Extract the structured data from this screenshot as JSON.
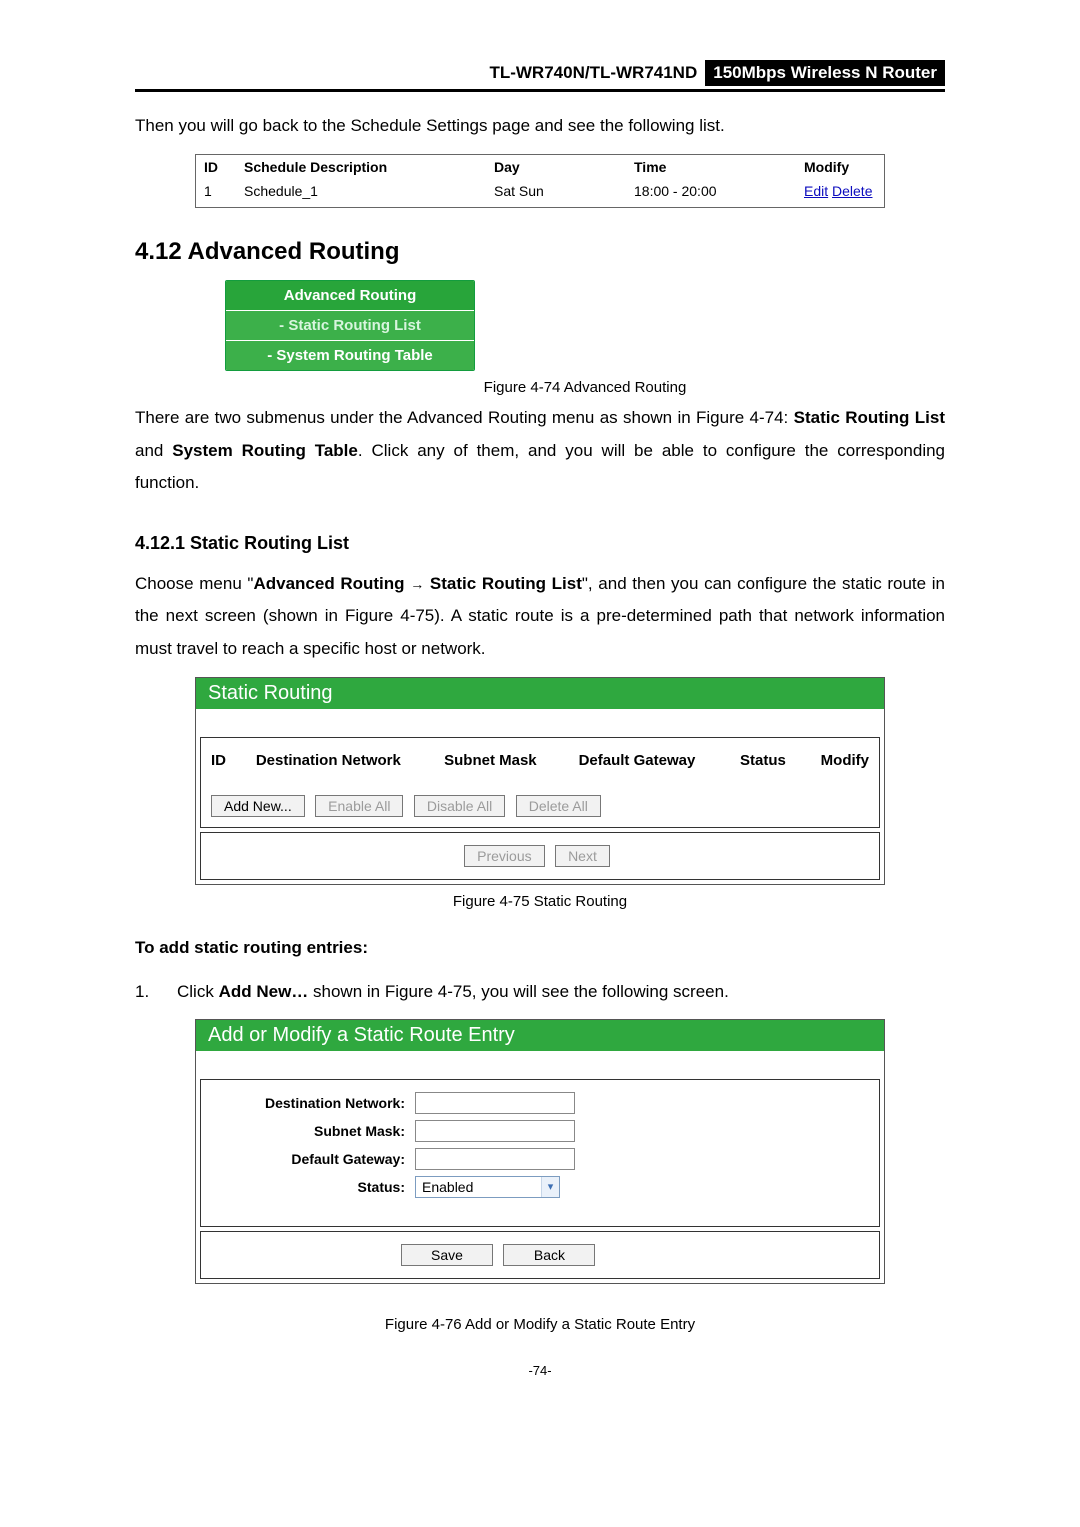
{
  "header": {
    "model": "TL-WR740N/TL-WR741ND",
    "product": "150Mbps Wireless N Router"
  },
  "intro_line": "Then you will go back to the Schedule Settings page and see the following list.",
  "schedule_table": {
    "headers": {
      "id": "ID",
      "desc": "Schedule Description",
      "day": "Day",
      "time": "Time",
      "modify": "Modify"
    },
    "row": {
      "id": "1",
      "desc": "Schedule_1",
      "day": "Sat Sun",
      "time": "18:00 - 20:00",
      "edit": "Edit",
      "delete": "Delete"
    }
  },
  "section_4_12": {
    "title": "4.12  Advanced Routing",
    "nav": {
      "head": "Advanced Routing",
      "item1": "- Static Routing List",
      "item2": "- System Routing Table"
    },
    "fig74": "Figure 4-74    Advanced Routing",
    "para_pre": "There are two submenus under the Advanced Routing menu as shown in Figure 4-74: ",
    "para_bold1": "Static Routing List",
    "para_mid": " and ",
    "para_bold2": "System Routing Table",
    "para_post": ". Click any of them, and you will be able to configure the corresponding function."
  },
  "section_4_12_1": {
    "title": "4.12.1  Static Routing List",
    "p1_a": "Choose menu \"",
    "p1_b": "Advanced Routing",
    "p1_c": "Static Routing List",
    "p1_d": "\", and then you can configure the static route in the next screen (shown in Figure 4-75). A static route is a pre-determined path that network information must travel to reach a specific host or network."
  },
  "static_routing_panel": {
    "title": "Static Routing",
    "cols": {
      "id": "ID",
      "dest": "Destination Network",
      "mask": "Subnet Mask",
      "gw": "Default Gateway",
      "status": "Status",
      "modify": "Modify"
    },
    "btns": {
      "add": "Add New...",
      "enable": "Enable All",
      "disable": "Disable All",
      "delete": "Delete All",
      "prev": "Previous",
      "next": "Next"
    },
    "fig75": "Figure 4-75    Static Routing"
  },
  "to_add_heading": "To add static routing entries:",
  "step1": {
    "num": "1.",
    "a": "Click ",
    "b": "Add New…",
    "c": " shown in Figure 4-75, you will see the following screen."
  },
  "add_modify_panel": {
    "title": "Add or Modify a Static Route Entry",
    "labels": {
      "dest": "Destination Network:",
      "mask": "Subnet Mask:",
      "gw": "Default Gateway:",
      "status": "Status:"
    },
    "status_value": "Enabled",
    "btns": {
      "save": "Save",
      "back": "Back"
    },
    "fig76": "Figure 4-76    Add or Modify a Static Route Entry"
  },
  "page_number": "-74-"
}
